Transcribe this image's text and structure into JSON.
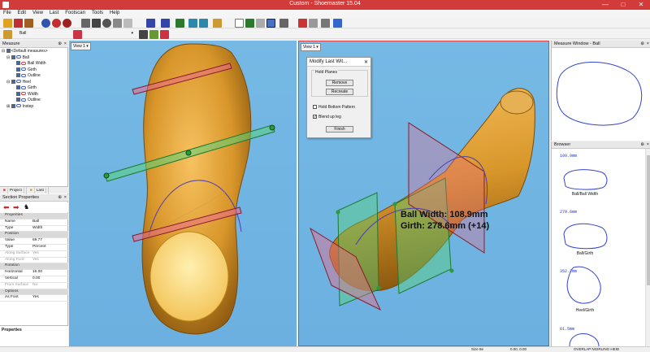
{
  "window": {
    "title": "Custom - Shoemaster 15.04",
    "minimize": "—",
    "maximize": "□",
    "close": "✕"
  },
  "menu": [
    "File",
    "Edit",
    "View",
    "Last",
    "Footscan",
    "Tools",
    "Help"
  ],
  "toolbar2": {
    "measure_dropdown": "Ball"
  },
  "measure_panel": {
    "title": "Measure",
    "tree": [
      {
        "label": "<Default measures>",
        "level": 0
      },
      {
        "label": "Ball",
        "level": 1
      },
      {
        "label": "Ball Width",
        "level": 2
      },
      {
        "label": "Girth",
        "level": 2
      },
      {
        "label": "Outline",
        "level": 2
      },
      {
        "label": "Heel",
        "level": 1
      },
      {
        "label": "Girth",
        "level": 2
      },
      {
        "label": "Width",
        "level": 2
      },
      {
        "label": "Outline",
        "level": 2
      },
      {
        "label": "Instep",
        "level": 1
      }
    ],
    "tabs": [
      "Project",
      "Last",
      "Measure"
    ]
  },
  "section_properties": {
    "title": "Section Properties",
    "rows": [
      {
        "section": "Properties"
      },
      {
        "k": "Name",
        "v": "Ball"
      },
      {
        "k": "Type",
        "v": "Width"
      },
      {
        "section": "Position"
      },
      {
        "k": "Value",
        "v": "69.77"
      },
      {
        "k": "Type",
        "v": "Percent"
      },
      {
        "k": "Along Surface",
        "v": "Yes",
        "disabled": true
      },
      {
        "k": "Along Foot",
        "v": "Yes",
        "disabled": true
      },
      {
        "section": "Rotation"
      },
      {
        "k": "Horizontal",
        "v": "16.00"
      },
      {
        "k": "Vertical",
        "v": "0.00"
      },
      {
        "k": "From Surface",
        "v": "No",
        "disabled": true
      },
      {
        "section": "Options"
      },
      {
        "k": "As Foot",
        "v": "Yes"
      }
    ],
    "bottom_label": "Properties"
  },
  "view1": {
    "label": "View 1 ▾"
  },
  "view2": {
    "label": "View 1 ▾",
    "overlay_line1": "Ball Width: 108.9mm",
    "overlay_line2": "Girth: 278.6mm (+14)"
  },
  "dialog": {
    "title": "Modify Last Wit...",
    "close": "✕",
    "group_label": "Hold Planes",
    "remove": "Remove",
    "recreate": "Recreate",
    "hold_bottom": "Hold Bottom Pattern",
    "blend_up": "Blend up leg",
    "blend_checked": "✓",
    "finish": "Finish"
  },
  "measure_window": {
    "title": "Measure Window - Ball"
  },
  "browser": {
    "title": "Browser",
    "items": [
      {
        "value": "109.9mm",
        "label": "Ball/Ball Width"
      },
      {
        "value": "279.6mm",
        "label": "Ball/Girth"
      },
      {
        "value": "352.2mm",
        "label": "Heel/Girth"
      },
      {
        "value": "61.5mm",
        "label": ""
      }
    ]
  },
  "statusbar": {
    "size": "Size 8e",
    "coords": "0.00, 0.00",
    "flags": "OVERLAP NGIRLING HEID"
  },
  "colors": {
    "titlebar": "#d33a3a",
    "viewport": "#6bb0e0",
    "shoe": "#d39a2a",
    "plane_green": "#44cc66",
    "plane_red": "#cc4455"
  }
}
